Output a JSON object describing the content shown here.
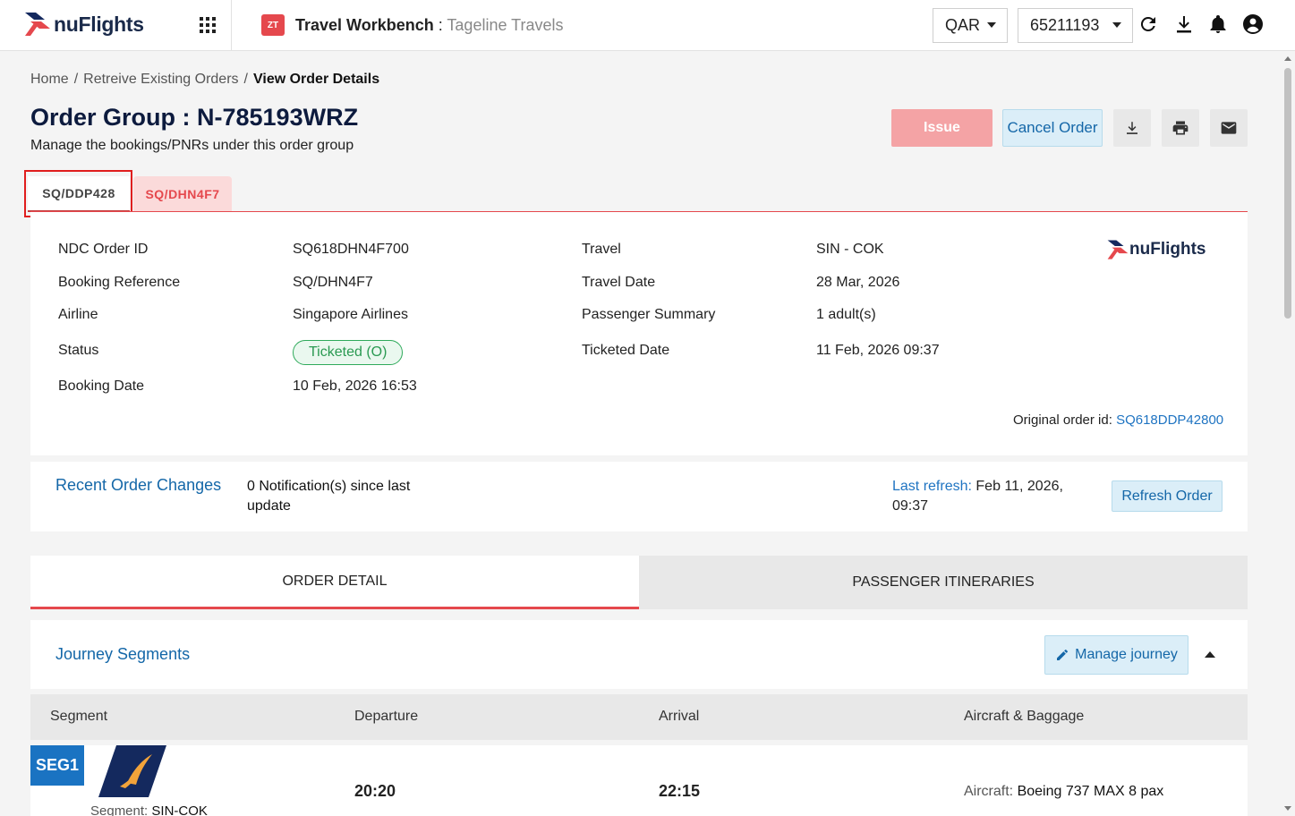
{
  "header": {
    "brand": "nuFlights",
    "workbench_title": "Travel Workbench",
    "title_separator": " : ",
    "agency": "Tageline Travels",
    "workbench_icon_text": "ZT",
    "currency": "QAR",
    "account": "65211193"
  },
  "breadcrumb": {
    "home": "Home",
    "sep": "/",
    "retrieve": "Retreive Existing Orders",
    "current": "View Order Details"
  },
  "page": {
    "title": "Order Group : N-785193WRZ",
    "subtitle": "Manage the bookings/PNRs under this order group"
  },
  "actions": {
    "issue": "Issue",
    "cancel": "Cancel Order"
  },
  "order_tabs": [
    "SQ/DDP428",
    "SQ/DHN4F7"
  ],
  "details": {
    "labels": {
      "ndc_order_id": "NDC Order ID",
      "booking_reference": "Booking Reference",
      "airline": "Airline",
      "status": "Status",
      "booking_date": "Booking Date",
      "travel": "Travel",
      "travel_date": "Travel Date",
      "passenger_summary": "Passenger Summary",
      "ticketed_date": "Ticketed Date"
    },
    "values": {
      "ndc_order_id": "SQ618DHN4F700",
      "booking_reference": "SQ/DHN4F7",
      "airline": "Singapore Airlines",
      "status": "Ticketed (O)",
      "booking_date": "10 Feb, 2026 16:53",
      "travel": "SIN - COK",
      "travel_date": "28 Mar, 2026",
      "passenger_summary": "1 adult(s)",
      "ticketed_date": "11 Feb, 2026 09:37"
    },
    "original_order_label": "Original order id:",
    "original_order_id": "SQ618DDP42800",
    "card_brand": "nuFlights"
  },
  "recent_changes": {
    "title": "Recent Order Changes",
    "notifications": "0 Notification(s) since last update",
    "last_refresh_label": "Last refresh:",
    "last_refresh_value": "Feb 11, 2026, 09:37",
    "refresh_button": "Refresh Order"
  },
  "section_tabs": [
    "ORDER DETAIL",
    "PASSENGER ITINERARIES"
  ],
  "journey": {
    "title": "Journey Segments",
    "manage_button": "Manage journey",
    "columns": [
      "Segment",
      "Departure",
      "Arrival",
      "Aircraft & Baggage"
    ],
    "segments": [
      {
        "badge": "SEG1",
        "segment_label": "Segment:",
        "segment": "SIN-COK",
        "departure": "20:20",
        "arrival": "22:15",
        "aircraft_label": "Aircraft:",
        "aircraft": "Boeing 737 MAX 8 pax"
      }
    ]
  },
  "colors": {
    "brand_red": "#e5484d",
    "link_blue": "#1467a8",
    "status_green": "#2a9a52",
    "seg_blue": "#1a73c2",
    "airline_navy": "#14295e",
    "airline_gold": "#f2a33a"
  },
  "icons": [
    "apps-grid-icon",
    "refresh-icon",
    "download-icon",
    "bell-icon",
    "user-account-icon",
    "print-icon",
    "mail-icon",
    "pencil-icon",
    "chevron-up-icon"
  ]
}
